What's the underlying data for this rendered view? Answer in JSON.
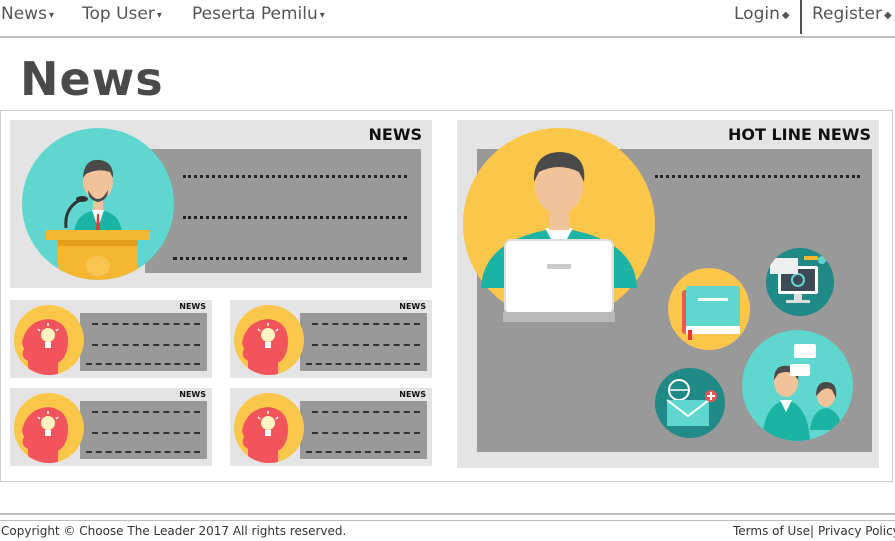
{
  "nav": {
    "items": [
      {
        "label": "News",
        "caret": "▾"
      },
      {
        "label": "Top User",
        "caret": "▾"
      },
      {
        "label": "Peserta Pemilu",
        "caret": "▾"
      }
    ],
    "login": {
      "label": "Login",
      "caret": "◆"
    },
    "register": {
      "label": "Register",
      "caret": "◆"
    }
  },
  "page": {
    "title": "News"
  },
  "main_news": {
    "label": "NEWS"
  },
  "small_news": [
    {
      "label": "NEWS"
    },
    {
      "label": "NEWS"
    },
    {
      "label": "NEWS"
    },
    {
      "label": "NEWS"
    }
  ],
  "hotline": {
    "label": "HOT LINE NEWS"
  },
  "footer": {
    "copyright": "Copyright © Choose The Leader 2017 All rights reserved.",
    "terms": "Terms of Use",
    "separator": "|",
    "privacy": "Privacy Policy"
  },
  "colors": {
    "teal": "#5fd7cf",
    "yellow": "#fbc74a",
    "orange_speaker": "#f5b731",
    "red_head": "#f2545b",
    "gray_box": "#999999",
    "card_bg": "#e4e4e4"
  },
  "icons": [
    "speaker-illustration",
    "person-laptop-illustration",
    "idea-head-icon",
    "book-icon",
    "computer-icon",
    "email-icon",
    "people-chat-icon"
  ]
}
